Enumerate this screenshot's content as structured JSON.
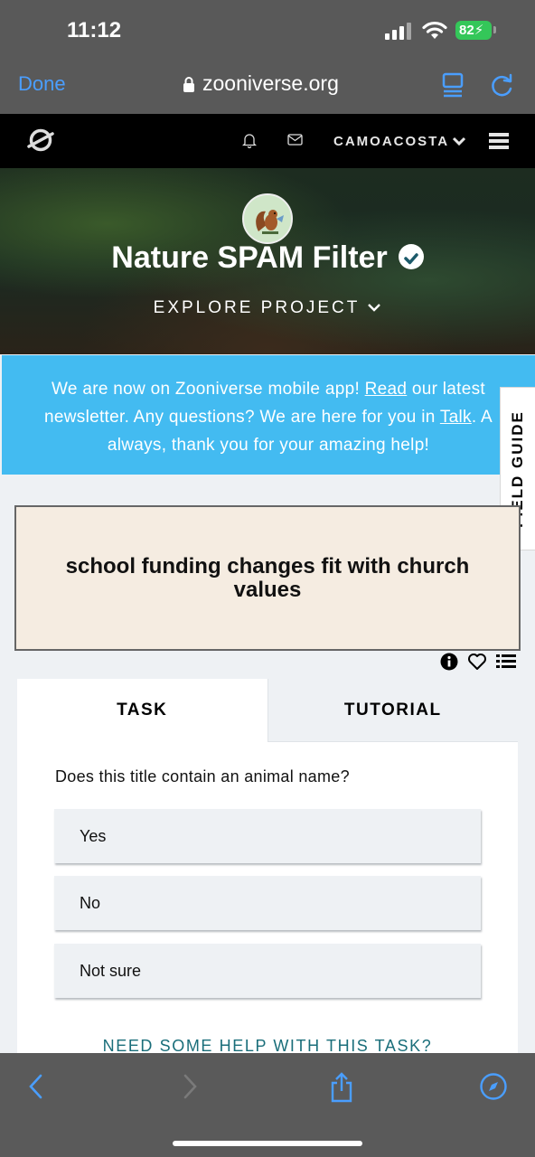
{
  "status_bar": {
    "time": "11:12",
    "battery": "82"
  },
  "browser": {
    "done_label": "Done",
    "url": "zooniverse.org"
  },
  "site_nav": {
    "username": "CAMOACOSTA"
  },
  "hero": {
    "title": "Nature SPAM Filter",
    "explore_label": "EXPLORE PROJECT"
  },
  "announcement": {
    "line1_a": "We are now on Zooniverse mobile app! ",
    "read_link": "Read",
    "line1_b": " our latest",
    "line2_a": "newsletter. Any questions? We are here for you in ",
    "talk_link": "Talk",
    "line2_b": ". A",
    "line3": "always, thank you for your amazing help!"
  },
  "field_guide_label": "FIELD GUIDE",
  "subject": {
    "text": "school funding changes fit with church values"
  },
  "task_panel": {
    "tabs": [
      {
        "label": "TASK"
      },
      {
        "label": "TUTORIAL"
      }
    ],
    "question": "Does this title contain an animal name?",
    "answers": [
      {
        "label": "Yes"
      },
      {
        "label": "No"
      },
      {
        "label": "Not sure"
      }
    ],
    "help_label": "NEED SOME HELP WITH THIS TASK?"
  },
  "colors": {
    "announcement_bg": "#43bbf1",
    "link_blue": "#4a9eff",
    "help_teal": "#1a6e7a",
    "subject_bg": "#f5ece1"
  }
}
